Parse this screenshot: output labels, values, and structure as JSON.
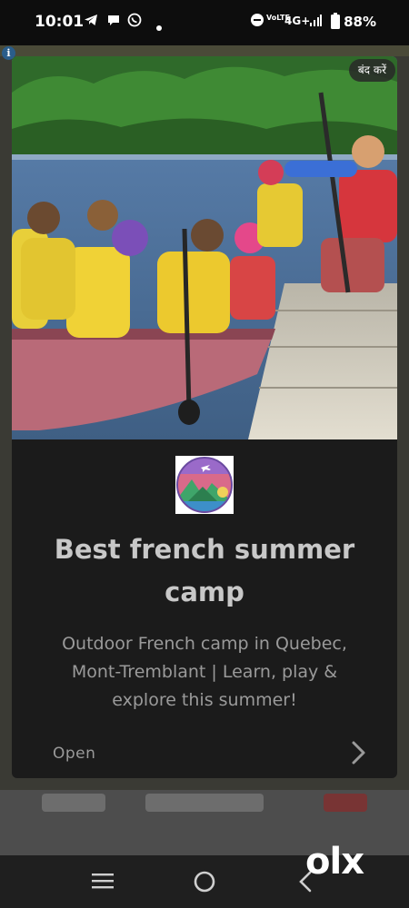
{
  "status_bar": {
    "time": "10:01",
    "icons": [
      "telegram-icon",
      "chat-bubble-icon",
      "whatsapp-icon",
      "dot-icon",
      "dnd-icon",
      "volte-icon",
      "signal-icon",
      "battery-icon"
    ],
    "network": "4G+",
    "volte": "VoLTE",
    "battery": "88%"
  },
  "ad": {
    "info_icon": "i",
    "close_label": "बंद करें",
    "headline": "Best french summer camp",
    "description": "Outdoor French camp in Quebec, Mont-Tremblant | Learn, play & explore this summer!",
    "cta_label": "Open",
    "cta_icon": "chevron-right-icon",
    "image_alt": "children in life jackets paddling a canoe at a lake dock"
  },
  "watermark": "olx",
  "nav_bar": {
    "items": [
      "recent-apps-icon",
      "home-icon",
      "back-icon"
    ]
  },
  "colors": {
    "card_background": "#1b1b1b",
    "headline": "#c8c8c8",
    "body_text": "#9a9a9a"
  }
}
